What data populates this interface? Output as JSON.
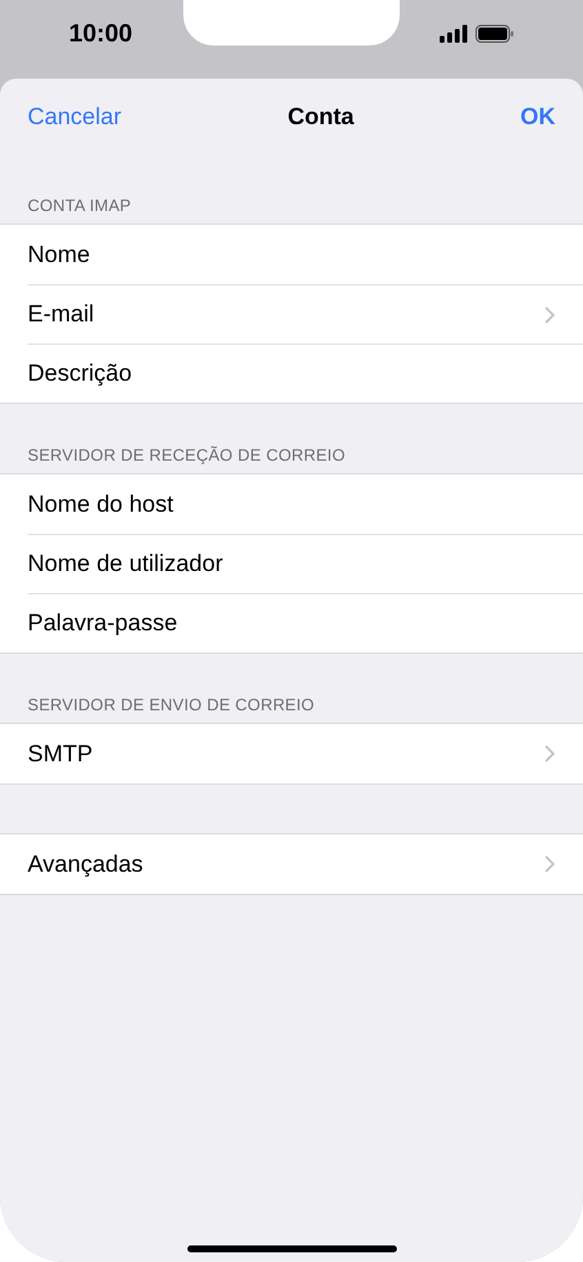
{
  "status_bar": {
    "time": "10:00"
  },
  "nav": {
    "cancel": "Cancelar",
    "title": "Conta",
    "ok": "OK"
  },
  "sections": [
    {
      "header": "CONTA IMAP",
      "rows": [
        {
          "label": "Nome",
          "chevron": false
        },
        {
          "label": "E-mail",
          "chevron": true
        },
        {
          "label": "Descrição",
          "chevron": false
        }
      ]
    },
    {
      "header": "SERVIDOR DE RECEÇÃO DE CORREIO",
      "rows": [
        {
          "label": "Nome do host",
          "chevron": false
        },
        {
          "label": "Nome de utilizador",
          "chevron": false
        },
        {
          "label": "Palavra-passe",
          "chevron": false
        }
      ]
    },
    {
      "header": "SERVIDOR DE ENVIO DE CORREIO",
      "rows": [
        {
          "label": "SMTP",
          "chevron": true
        }
      ]
    },
    {
      "rows": [
        {
          "label": "Avançadas",
          "chevron": true
        }
      ]
    }
  ]
}
